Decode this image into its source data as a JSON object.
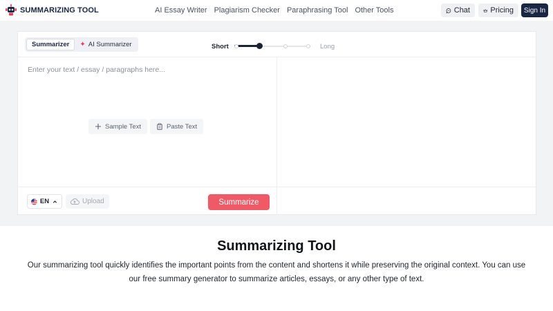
{
  "header": {
    "logo_text": "SUMMARIZING TOOL",
    "nav": [
      "AI Essay Writer",
      "Plagiarism Checker",
      "Paraphrasing Tool",
      "Other Tools"
    ],
    "chat_label": "Chat",
    "pricing_label": "Pricing",
    "signin_label": "Sign In"
  },
  "tool": {
    "tabs": [
      {
        "label": "Summarizer",
        "active": true
      },
      {
        "label": "AI Summarizer",
        "active": false
      }
    ],
    "length": {
      "short_label": "Short",
      "long_label": "Long",
      "level": 0.33
    },
    "input_placeholder": "Enter your text / essay / paragraphs here...",
    "sample_text_label": "Sample Text",
    "paste_text_label": "Paste Text",
    "language": "EN",
    "upload_label": "Upload",
    "summarize_label": "Summarize"
  },
  "description": {
    "title": "Summarizing Tool",
    "text": "Our summarizing tool quickly identifies the important points from the content and shortens it while preserving the original context. You can use our free summary generator to summarize articles, essays, or any other type of text."
  },
  "colors": {
    "brand_navy": "#1a2744",
    "accent_red": "#f05a67",
    "band_gray": "#f2f3f5"
  }
}
